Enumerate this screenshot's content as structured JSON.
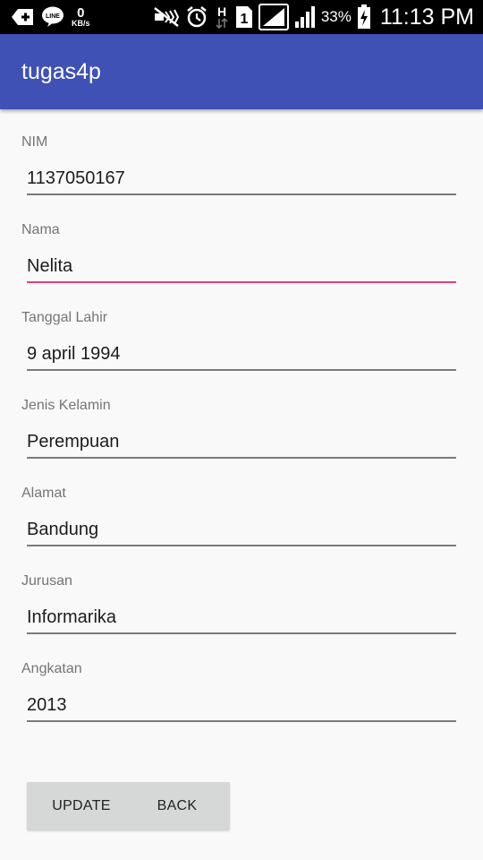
{
  "status_bar": {
    "icons": [
      "add-icon",
      "line-icon",
      "mute-icon",
      "alarm-icon",
      "h-network-icon",
      "sim-1-icon",
      "signal-icon",
      "signal-icon-2",
      "battery-charging-icon"
    ],
    "speed_value": "0",
    "speed_unit": "KB/s",
    "h_label": "H",
    "sim_label": "1",
    "battery_percent": "33%",
    "time": "11:13 PM"
  },
  "app_bar": {
    "title": "tugas4p",
    "color": "#3f51b5"
  },
  "form": {
    "fields": [
      {
        "label": "NIM",
        "value": "1137050167"
      },
      {
        "label": "Nama",
        "value": "Nelita"
      },
      {
        "label": "Tanggal Lahir",
        "value": "9 april 1994"
      },
      {
        "label": "Jenis Kelamin",
        "value": "Perempuan"
      },
      {
        "label": "Alamat",
        "value": "Bandung"
      },
      {
        "label": "Jurusan",
        "value": "Informarika"
      },
      {
        "label": "Angkatan",
        "value": "2013"
      }
    ],
    "focused_field": "Nama",
    "focus_color": "#e6407a"
  },
  "buttons": {
    "update": "UPDATE",
    "back": "BACK"
  }
}
